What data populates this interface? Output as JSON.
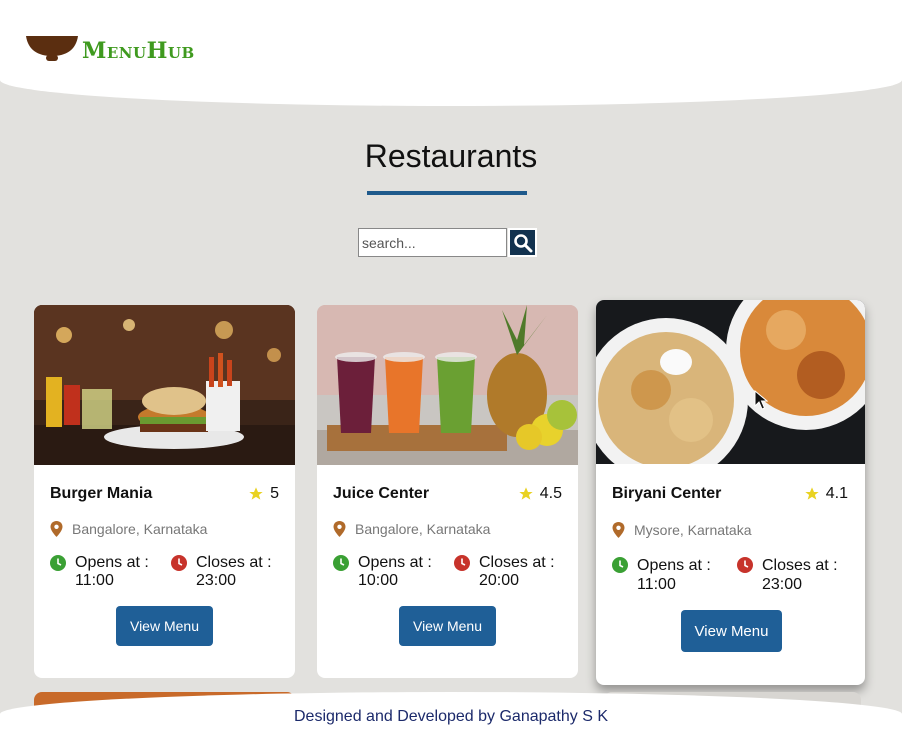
{
  "app": {
    "logo_text": "MenuHub",
    "brand_color": "#3f9a1f",
    "accent_color": "#1f5f97"
  },
  "main": {
    "title": "Restaurants",
    "search": {
      "placeholder": "search...",
      "value": ""
    }
  },
  "restaurants": [
    {
      "name": "Burger Mania",
      "rating": "5",
      "location": "Bangalore, Karnataka",
      "opens_label": "Opens at :",
      "opens_time": "11:00",
      "closes_label": "Closes at :",
      "closes_time": "23:00",
      "button_label": "View Menu"
    },
    {
      "name": "Juice Center",
      "rating": "4.5",
      "location": "Bangalore, Karnataka",
      "opens_label": "Opens at :",
      "opens_time": "10:00",
      "closes_label": "Closes at :",
      "closes_time": "20:00",
      "button_label": "View Menu"
    },
    {
      "name": "Biryani Center",
      "rating": "4.1",
      "location": "Mysore, Karnataka",
      "opens_label": "Opens at :",
      "opens_time": "11:00",
      "closes_label": "Closes at :",
      "closes_time": "23:00",
      "button_label": "View Menu"
    }
  ],
  "footer": {
    "text": "Designed and Developed by Ganapathy S K"
  },
  "icons": {
    "logo": "bowl-icon",
    "search": "search-icon",
    "rating": "star-icon",
    "location": "location-pin-icon",
    "opens": "clock-green-icon",
    "closes": "clock-red-icon"
  }
}
